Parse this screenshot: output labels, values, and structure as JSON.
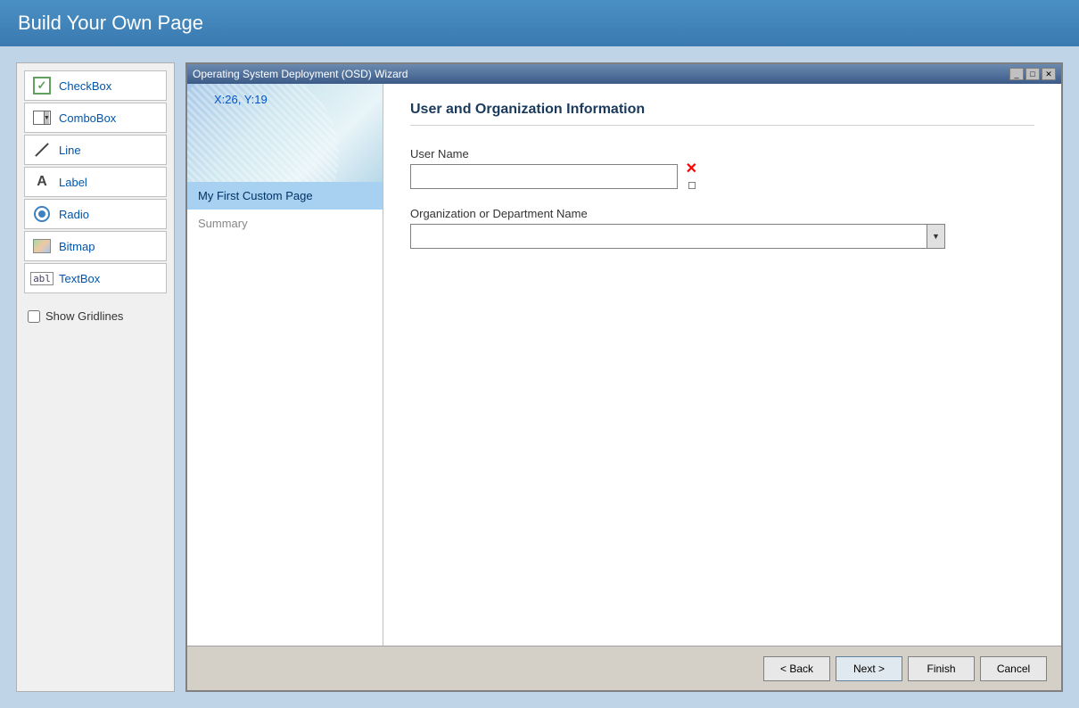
{
  "page": {
    "title": "Build Your Own Page"
  },
  "toolbox": {
    "items": [
      {
        "id": "checkbox",
        "label": "CheckBox",
        "icon": "checkbox-icon"
      },
      {
        "id": "combobox",
        "label": "ComboBox",
        "icon": "combobox-icon"
      },
      {
        "id": "line",
        "label": "Line",
        "icon": "line-icon"
      },
      {
        "id": "label",
        "label": "Label",
        "icon": "label-icon"
      },
      {
        "id": "radio",
        "label": "Radio",
        "icon": "radio-icon"
      },
      {
        "id": "bitmap",
        "label": "Bitmap",
        "icon": "bitmap-icon"
      },
      {
        "id": "textbox",
        "label": "TextBox",
        "icon": "textbox-icon"
      }
    ],
    "show_gridlines_label": "Show Gridlines"
  },
  "wizard": {
    "title": "Operating System Deployment (OSD) Wizard",
    "coords": "X:26, Y:19",
    "nav_items": [
      {
        "id": "custom-page",
        "label": "My First Custom Page",
        "active": true
      },
      {
        "id": "summary",
        "label": "Summary",
        "active": false
      }
    ],
    "section_title": "User and Organization Information",
    "fields": [
      {
        "id": "user-name",
        "label": "User Name",
        "type": "text",
        "value": "",
        "placeholder": ""
      },
      {
        "id": "org-dept",
        "label": "Organization or Department Name",
        "type": "combo",
        "value": "",
        "placeholder": ""
      }
    ],
    "buttons": {
      "back": "< Back",
      "next": "Next >",
      "finish": "Finish",
      "cancel": "Cancel"
    }
  }
}
